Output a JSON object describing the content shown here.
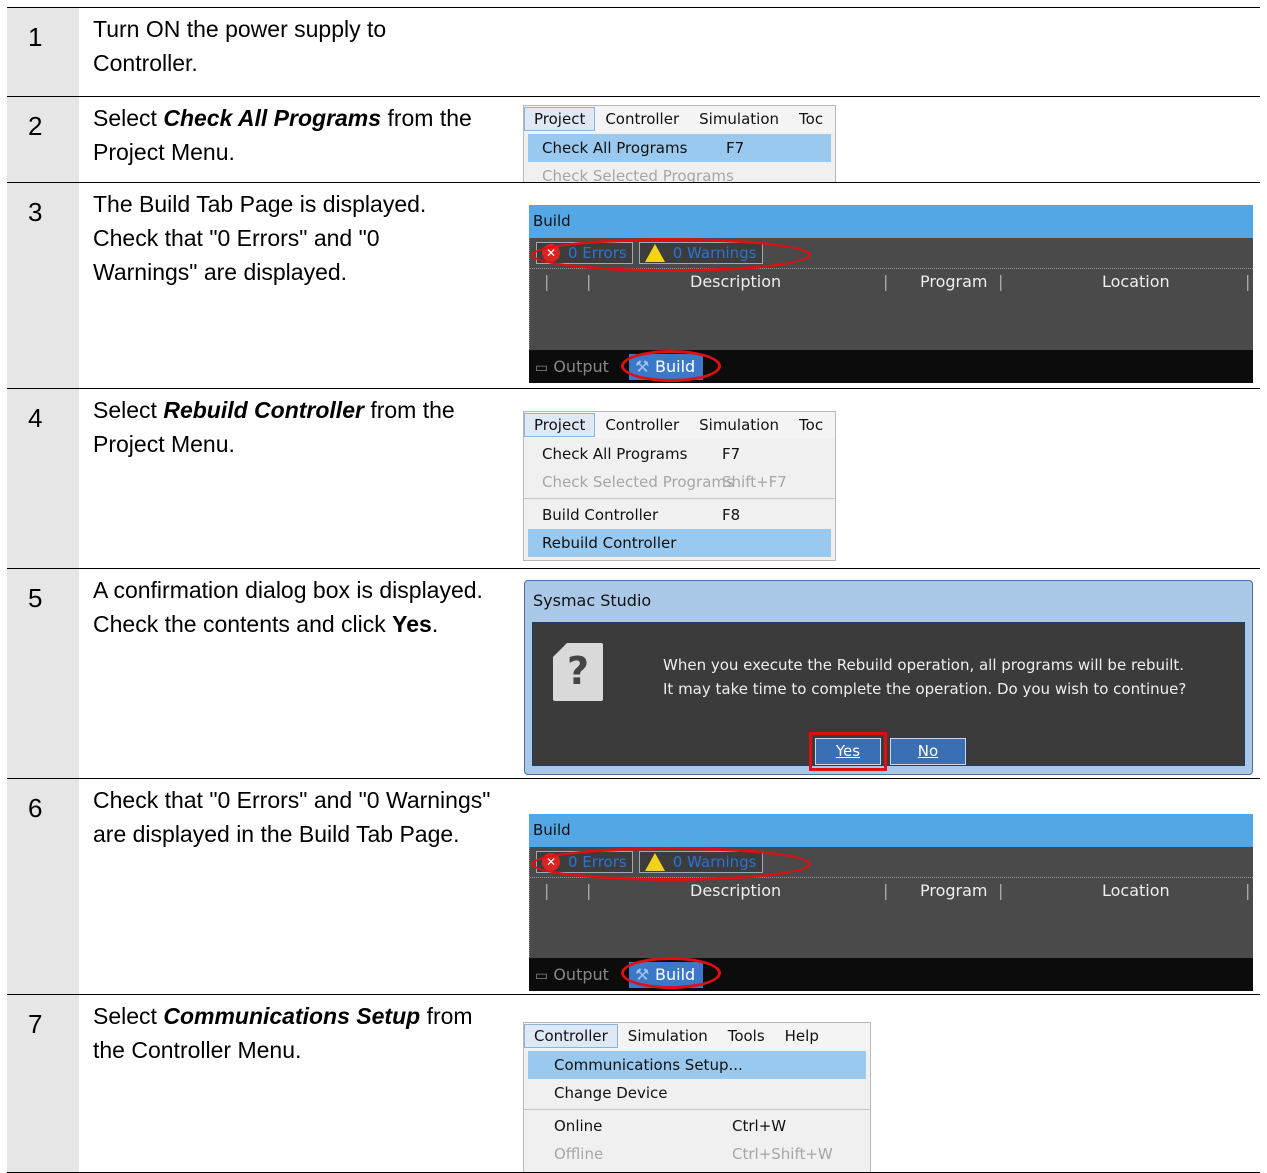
{
  "steps": [
    {
      "num": "1",
      "text": "Turn ON the power supply to Controller."
    },
    {
      "num": "2",
      "pre": "Select ",
      "bold": "Check All Programs",
      "post": " from the Project Menu."
    },
    {
      "num": "3",
      "line1": "The Build Tab Page is displayed.",
      "line2": "Check that \"0 Errors\" and \"0 Warnings\" are displayed."
    },
    {
      "num": "4",
      "pre": "Select ",
      "bold": "Rebuild Controller",
      "post": " from the Project Menu."
    },
    {
      "num": "5",
      "pre": "A confirmation dialog box is displayed. Check the contents and click ",
      "bold": "Yes",
      "post": "."
    },
    {
      "num": "6",
      "text": "Check that \"0 Errors\" and \"0 Warnings\" are displayed in the Build Tab Page."
    },
    {
      "num": "7",
      "pre": "Select ",
      "bold": "Communications Setup",
      "post": " from the Controller Menu."
    }
  ],
  "project_menu": {
    "bar": [
      "Project",
      "Controller",
      "Simulation",
      "Toc"
    ],
    "check_all": {
      "label": "Check All Programs",
      "shortcut": "F7"
    },
    "check_selected": {
      "label": "Check Selected Programs",
      "shortcut": "Shift+F7"
    },
    "build_controller": {
      "label": "Build Controller",
      "shortcut": "F8"
    },
    "rebuild_controller": {
      "label": "Rebuild Controller"
    }
  },
  "build_panel": {
    "title": "Build",
    "errors": "0  Errors",
    "warnings": "0  Warnings",
    "columns": [
      "Description",
      "Program",
      "Location"
    ],
    "tabs": {
      "output": "Output",
      "build": "Build"
    }
  },
  "dialog": {
    "title": "Sysmac Studio",
    "line1": "When you execute the Rebuild operation, all programs will be rebuilt.",
    "line2": "It may take time to complete the operation. Do you wish to continue?",
    "yes": "Yes",
    "no": "No"
  },
  "controller_menu": {
    "bar": [
      "Controller",
      "Simulation",
      "Tools",
      "Help"
    ],
    "items": [
      {
        "label": "Communications Setup...",
        "shortcut": ""
      },
      {
        "label": "Change Device",
        "shortcut": ""
      },
      {
        "label": "Online",
        "shortcut": "Ctrl+W"
      },
      {
        "label": "Offline",
        "shortcut": "Ctrl+Shift+W"
      }
    ]
  },
  "colors": {
    "highlight": "#99c9ef",
    "build_title": "#53a7e6",
    "ring": "#e01010",
    "step_bg": "#e6e6e6"
  }
}
